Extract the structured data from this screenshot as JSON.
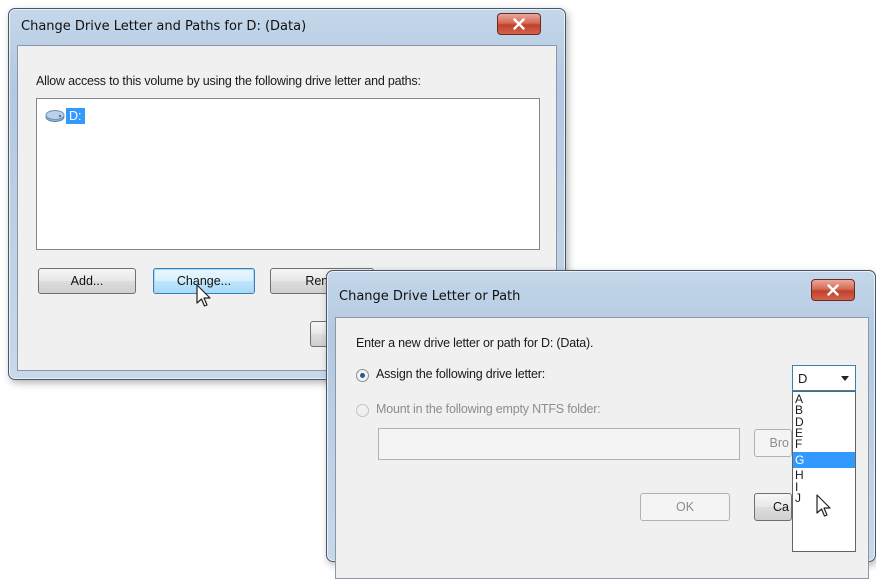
{
  "dialog1": {
    "title": "Change Drive Letter and Paths for D: (Data)",
    "instruction": "Allow access to this volume by using the following drive letter and paths:",
    "list_items": [
      {
        "label": "D:",
        "icon": "drive-icon"
      }
    ],
    "buttons": {
      "add": "Add...",
      "change": "Change...",
      "remove": "Remo"
    }
  },
  "dialog2": {
    "title": "Change Drive Letter or Path",
    "instruction": "Enter a new drive letter or path for D: (Data).",
    "option_assign": "Assign the following drive letter:",
    "option_mount": "Mount in the following empty NTFS folder:",
    "folder_path": "",
    "buttons": {
      "browse": "Bro",
      "ok": "OK",
      "cancel": "Ca"
    },
    "drive_select": {
      "selected": "D",
      "options": [
        "A",
        "B",
        "D",
        "E",
        "F",
        "G",
        "H",
        "I",
        "J"
      ],
      "highlighted": "G"
    }
  },
  "colors": {
    "close_button": "#c9452f",
    "selection": "#3399ff",
    "window_frame": "#b9cfe6"
  }
}
